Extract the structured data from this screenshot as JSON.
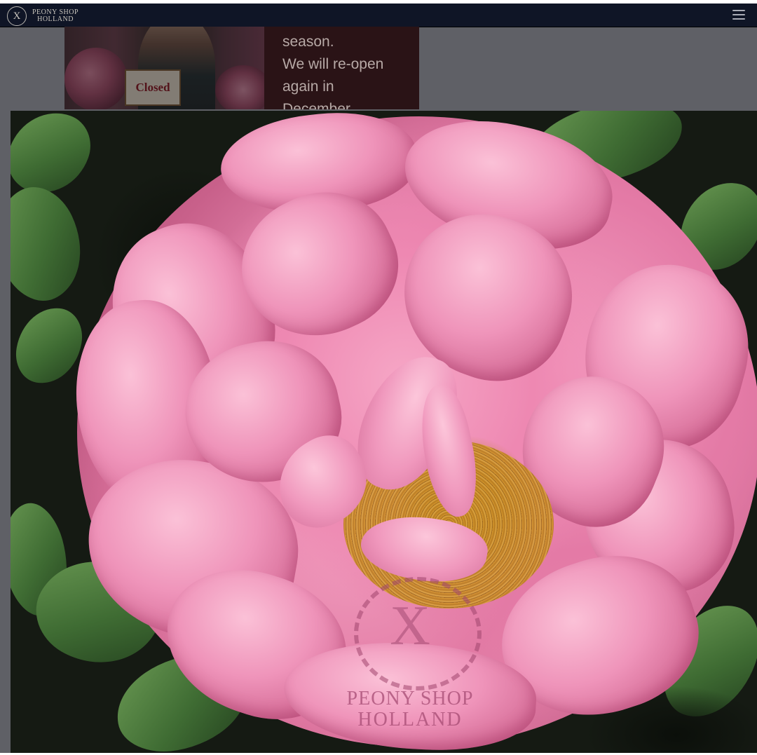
{
  "header": {
    "logo_mark": "X",
    "logo_line1": "PEONY SHOP",
    "logo_line2": "HOLLAND",
    "menu_icon": "hamburger-menu-icon"
  },
  "banner": {
    "sign_text": "Closed",
    "lines": [
      "season.",
      "We will re-open",
      "again in",
      "December"
    ]
  },
  "lightbox": {
    "image_subject": "pink-peony-photo",
    "watermark_mark": "X",
    "watermark_line1": "PEONY SHOP",
    "watermark_line2": "HOLLAND"
  },
  "colors": {
    "topbar": "#0f1526",
    "overlay": "#5f6066",
    "banner_box": "#2a1316",
    "peony_pink": "#ea8db4",
    "stamen_gold": "#d89a2e",
    "leaf_green": "#3f6c33"
  }
}
